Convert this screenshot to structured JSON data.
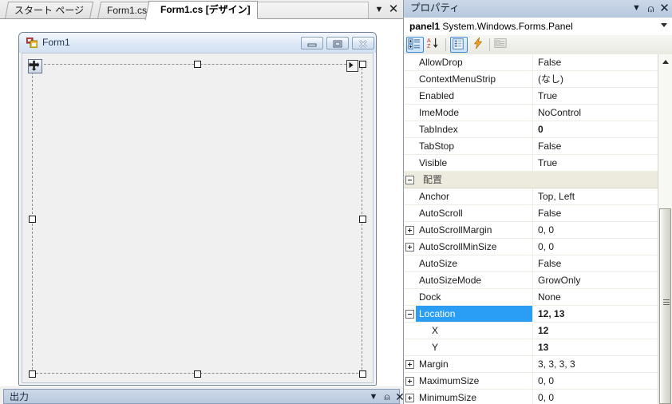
{
  "tabs": {
    "items": [
      {
        "label": "スタート ページ",
        "active": false
      },
      {
        "label": "Form1.cs",
        "active": false
      },
      {
        "label": "Form1.cs [デザイン]",
        "active": true
      }
    ],
    "dropdown_icon": "chevron-down-icon",
    "close_icon": "close-icon"
  },
  "designer": {
    "form": {
      "title": "Form1",
      "icon": "form-designer-icon",
      "minimize_icon": "minimize-icon",
      "maximize_icon": "maximize-icon",
      "close_icon": "close-icon"
    },
    "selection": {
      "control": "panel1",
      "smart_tag_icon": "smart-tag-icon",
      "move_grip_icon": "move-grip-icon"
    }
  },
  "output_pane": {
    "title": "出力",
    "dropdown_icon": "chevron-down-icon",
    "pin_icon": "pin-icon",
    "close_icon": "close-icon"
  },
  "properties": {
    "header": {
      "title": "プロパティ",
      "dropdown_icon": "chevron-down-icon",
      "pin_icon": "pin-icon",
      "close_icon": "close-icon"
    },
    "object_selector": {
      "name": "panel1",
      "type": "System.Windows.Forms.Panel",
      "arrow_icon": "chevron-down-icon"
    },
    "toolbar": [
      {
        "name": "categorized-button",
        "icon": "categorized-icon",
        "selected": true
      },
      {
        "name": "alphabetical-button",
        "icon": "alphabetical-sort-icon",
        "selected": false
      },
      {
        "name": "properties-button",
        "icon": "properties-list-icon",
        "selected": true
      },
      {
        "name": "events-button",
        "icon": "lightning-bolt-icon",
        "selected": false
      },
      {
        "name": "property-pages-button",
        "icon": "property-pages-icon",
        "selected": false
      }
    ],
    "rows": [
      {
        "name": "AllowDrop",
        "value": "False",
        "kind": "prop"
      },
      {
        "name": "ContextMenuStrip",
        "value": "(なし)",
        "kind": "prop"
      },
      {
        "name": "Enabled",
        "value": "True",
        "kind": "prop"
      },
      {
        "name": "ImeMode",
        "value": "NoControl",
        "kind": "prop"
      },
      {
        "name": "TabIndex",
        "value": "0",
        "kind": "prop",
        "bold": true
      },
      {
        "name": "TabStop",
        "value": "False",
        "kind": "prop"
      },
      {
        "name": "Visible",
        "value": "True",
        "kind": "prop"
      },
      {
        "name": "配置",
        "value": "",
        "kind": "category",
        "expander": "minus"
      },
      {
        "name": "Anchor",
        "value": "Top, Left",
        "kind": "prop"
      },
      {
        "name": "AutoScroll",
        "value": "False",
        "kind": "prop"
      },
      {
        "name": "AutoScrollMargin",
        "value": "0, 0",
        "kind": "prop",
        "expander": "plus"
      },
      {
        "name": "AutoScrollMinSize",
        "value": "0, 0",
        "kind": "prop",
        "expander": "plus"
      },
      {
        "name": "AutoSize",
        "value": "False",
        "kind": "prop"
      },
      {
        "name": "AutoSizeMode",
        "value": "GrowOnly",
        "kind": "prop"
      },
      {
        "name": "Dock",
        "value": "None",
        "kind": "prop"
      },
      {
        "name": "Location",
        "value": "12, 13",
        "kind": "prop",
        "expander": "minus",
        "selected": true,
        "bold": true
      },
      {
        "name": "X",
        "value": "12",
        "kind": "sub",
        "bold": true
      },
      {
        "name": "Y",
        "value": "13",
        "kind": "sub",
        "bold": true
      },
      {
        "name": "Margin",
        "value": "3, 3, 3, 3",
        "kind": "prop",
        "expander": "plus"
      },
      {
        "name": "MaximumSize",
        "value": "0, 0",
        "kind": "prop",
        "expander": "plus"
      },
      {
        "name": "MinimumSize",
        "value": "0, 0",
        "kind": "prop",
        "expander": "plus"
      }
    ],
    "scrollbar": {
      "up_icon": "scroll-up-icon"
    }
  },
  "colors": {
    "selection_blue": "#2a9df4",
    "category_bg": "#edeade",
    "panel_header": "#bdcee2",
    "form_chrome": "#dce8f6"
  }
}
